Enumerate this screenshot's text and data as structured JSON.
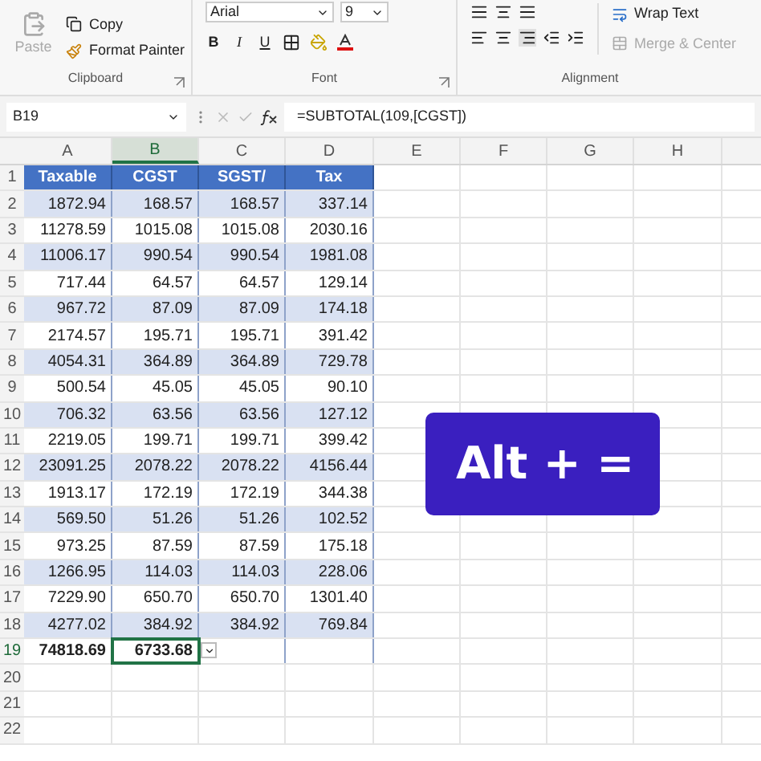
{
  "ribbon": {
    "clipboard": {
      "paste": {
        "label": "Paste",
        "disabled": true
      },
      "copy": "Copy",
      "format_painter": "Format Painter",
      "label": "Clipboard"
    },
    "font": {
      "font_name": "Arial",
      "font_size": "9",
      "style_buttons": [
        "B",
        "I",
        "U"
      ],
      "label": "Font"
    },
    "alignment": {
      "wrap_text": {
        "label": "Wrap Text",
        "disabled": false
      },
      "merge_center": {
        "label": "Merge & Center",
        "disabled": true
      },
      "label": "Alignment"
    }
  },
  "formula_bar": {
    "name_box": "B19",
    "formula": "=SUBTOTAL(109,[CGST])"
  },
  "sheet": {
    "columns": [
      {
        "label": "A",
        "selected": false
      },
      {
        "label": "B",
        "selected": true
      },
      {
        "label": "C",
        "selected": false
      },
      {
        "label": "D",
        "selected": false
      },
      {
        "label": "E",
        "selected": false
      },
      {
        "label": "F",
        "selected": false
      },
      {
        "label": "G",
        "selected": false
      },
      {
        "label": "H",
        "selected": false
      }
    ],
    "rows": [
      {
        "number": "1",
        "kind": "header",
        "banded": false,
        "selected": false,
        "cells": [
          "Taxable",
          "CGST",
          "SGST/",
          "Tax"
        ]
      },
      {
        "number": "2",
        "kind": "data",
        "banded": true,
        "selected": false,
        "cells": [
          "1872.94",
          "168.57",
          "168.57",
          "337.14"
        ]
      },
      {
        "number": "3",
        "kind": "data",
        "banded": false,
        "selected": false,
        "cells": [
          "11278.59",
          "1015.08",
          "1015.08",
          "2030.16"
        ]
      },
      {
        "number": "4",
        "kind": "data",
        "banded": true,
        "selected": false,
        "cells": [
          "11006.17",
          "990.54",
          "990.54",
          "1981.08"
        ]
      },
      {
        "number": "5",
        "kind": "data",
        "banded": false,
        "selected": false,
        "cells": [
          "717.44",
          "64.57",
          "64.57",
          "129.14"
        ]
      },
      {
        "number": "6",
        "kind": "data",
        "banded": true,
        "selected": false,
        "cells": [
          "967.72",
          "87.09",
          "87.09",
          "174.18"
        ]
      },
      {
        "number": "7",
        "kind": "data",
        "banded": false,
        "selected": false,
        "cells": [
          "2174.57",
          "195.71",
          "195.71",
          "391.42"
        ]
      },
      {
        "number": "8",
        "kind": "data",
        "banded": true,
        "selected": false,
        "cells": [
          "4054.31",
          "364.89",
          "364.89",
          "729.78"
        ]
      },
      {
        "number": "9",
        "kind": "data",
        "banded": false,
        "selected": false,
        "cells": [
          "500.54",
          "45.05",
          "45.05",
          "90.10"
        ]
      },
      {
        "number": "10",
        "kind": "data",
        "banded": true,
        "selected": false,
        "cells": [
          "706.32",
          "63.56",
          "63.56",
          "127.12"
        ]
      },
      {
        "number": "11",
        "kind": "data",
        "banded": false,
        "selected": false,
        "cells": [
          "2219.05",
          "199.71",
          "199.71",
          "399.42"
        ]
      },
      {
        "number": "12",
        "kind": "data",
        "banded": true,
        "selected": false,
        "cells": [
          "23091.25",
          "2078.22",
          "2078.22",
          "4156.44"
        ]
      },
      {
        "number": "13",
        "kind": "data",
        "banded": false,
        "selected": false,
        "cells": [
          "1913.17",
          "172.19",
          "172.19",
          "344.38"
        ]
      },
      {
        "number": "14",
        "kind": "data",
        "banded": true,
        "selected": false,
        "cells": [
          "569.50",
          "51.26",
          "51.26",
          "102.52"
        ]
      },
      {
        "number": "15",
        "kind": "data",
        "banded": false,
        "selected": false,
        "cells": [
          "973.25",
          "87.59",
          "87.59",
          "175.18"
        ]
      },
      {
        "number": "16",
        "kind": "data",
        "banded": true,
        "selected": false,
        "cells": [
          "1266.95",
          "114.03",
          "114.03",
          "228.06"
        ]
      },
      {
        "number": "17",
        "kind": "data",
        "banded": false,
        "selected": false,
        "cells": [
          "7229.90",
          "650.70",
          "650.70",
          "1301.40"
        ]
      },
      {
        "number": "18",
        "kind": "data",
        "banded": true,
        "selected": false,
        "cells": [
          "4277.02",
          "384.92",
          "384.92",
          "769.84"
        ]
      },
      {
        "number": "19",
        "kind": "total",
        "banded": false,
        "selected": true,
        "cells": [
          "74818.69",
          "6733.68"
        ]
      },
      {
        "number": "20",
        "kind": "empty",
        "selected": false,
        "cells": []
      },
      {
        "number": "21",
        "kind": "empty",
        "selected": false,
        "cells": []
      },
      {
        "number": "22",
        "kind": "empty",
        "selected": false,
        "cells": []
      }
    ]
  },
  "overlay": {
    "shortcut_label": "Alt + ="
  }
}
